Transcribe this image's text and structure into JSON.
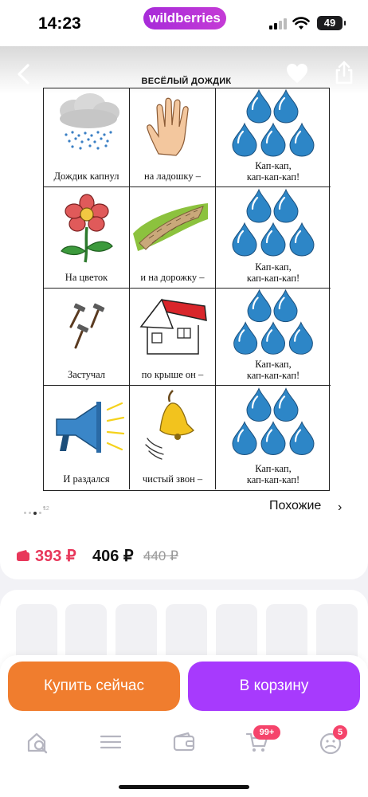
{
  "status_bar": {
    "time": "14:23",
    "brand": "wildberries",
    "battery": "49"
  },
  "product_image": {
    "title": "ВЕСЁЛЫЙ ДОЖДИК",
    "rows": [
      {
        "line": "Дождик капнул",
        "phrase": "на ладошку –",
        "refrain_1": "Кап-кап,",
        "refrain_2": "кап-кап-кап!"
      },
      {
        "line": "На цветок",
        "phrase": "и на дорожку –",
        "refrain_1": "Кап-кап,",
        "refrain_2": "кап-кап-кап!"
      },
      {
        "line": "Застучал",
        "phrase": "по крыше он –",
        "refrain_1": "Кап-кап,",
        "refrain_2": "кап-кап-кап!"
      },
      {
        "line": "И раздался",
        "phrase": "чистый звон –",
        "refrain_1": "Кап-кап,",
        "refrain_2": "кап-кап-кап!"
      }
    ],
    "icons": [
      "rain-cloud-icon",
      "hand-icon",
      "raindrops-icon",
      "flower-icon",
      "path-icon",
      "hammers-icon",
      "house-icon",
      "megaphone-icon",
      "bell-icon"
    ]
  },
  "gallery": {
    "page_number": "12",
    "similar_label": "Похожие",
    "similar_chevron": "›"
  },
  "price": {
    "current": "393 ₽",
    "secondary": "406 ₽",
    "old": "440 ₽"
  },
  "actions": {
    "buy_now": "Купить сейчас",
    "add_to_cart": "В корзину"
  },
  "tab_bar": {
    "cart_badge": "99+",
    "profile_badge": "5"
  },
  "colors": {
    "brand": "#a72bd9",
    "buy": "#f07d2e",
    "cart": "#a73afd",
    "price": "#e8375a",
    "badge": "#f5446b",
    "drop": "#2d86c7"
  }
}
